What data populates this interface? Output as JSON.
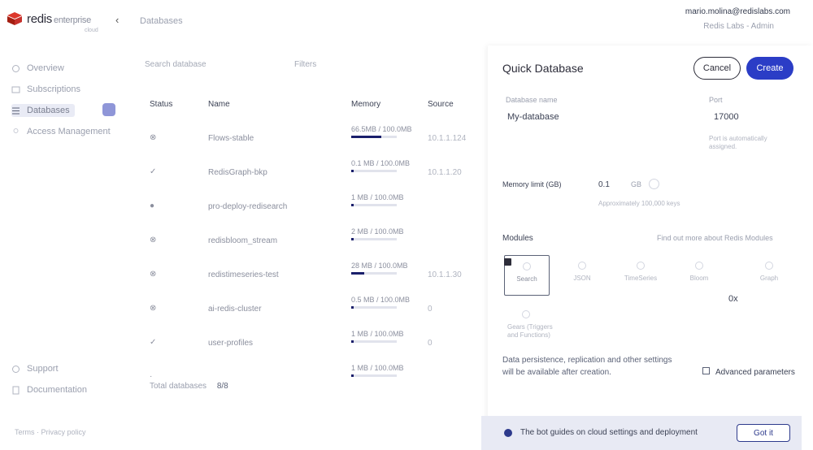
{
  "app": {
    "name": "redis",
    "edition": "enterprise",
    "sub": "cloud",
    "breadcrumb": "Databases"
  },
  "account": {
    "email": "mario.molina@redislabs.com",
    "plan": "Redis Labs - Admin"
  },
  "sidebar": {
    "items": [
      {
        "label": "Overview",
        "icon": "overview-icon"
      },
      {
        "label": "Subscriptions",
        "icon": "subscriptions-icon"
      },
      {
        "label": "Databases",
        "icon": "databases-icon"
      },
      {
        "label": "Access Management",
        "icon": "access-management-icon"
      },
      {
        "label": "Support",
        "icon": "support-icon"
      },
      {
        "label": "Documentation",
        "icon": "documentation-icon"
      }
    ],
    "footer": "Terms · Privacy policy"
  },
  "list": {
    "search_placeholder": "Search database",
    "filter_label": "Filters",
    "columns": [
      "Status",
      "Name",
      "Memory",
      "Source"
    ],
    "rows": [
      {
        "status": "",
        "name": "Flows-stable",
        "memory": "66.5MB / 100.0MB",
        "fill": 0.66,
        "source": "10.1.1.124"
      },
      {
        "status": "",
        "name": "RedisGraph-bkp",
        "memory": "0.1 MB / 100.0MB",
        "fill": 0.02,
        "source": "10.1.1.20"
      },
      {
        "status": "",
        "name": "pro-deploy-redisearch",
        "memory": "1 MB / 100.0MB",
        "fill": 0.02,
        "source": ""
      },
      {
        "status": "",
        "name": "redisbloom_stream",
        "memory": "2 MB / 100.0MB",
        "fill": 0.02,
        "source": ""
      },
      {
        "status": "",
        "name": "redistimeseries-test",
        "memory": "28 MB / 100.0MB",
        "fill": 0.28,
        "source": "10.1.1.30"
      },
      {
        "status": "",
        "name": "ai-redis-cluster",
        "memory": "0.5 MB / 100.0MB",
        "fill": 0.01,
        "source": "0"
      },
      {
        "status": "",
        "name": "user-profiles",
        "memory": "1 MB / 100.0MB",
        "fill": 0.02,
        "source": "0"
      },
      {
        "status": "",
        "name": "",
        "memory": "1 MB / 100.0MB",
        "fill": 0.02,
        "source": ""
      }
    ],
    "footer_label": "Total databases",
    "footer_value": "8/8"
  },
  "panel": {
    "title": "Quick Database",
    "cancel_label": "Cancel",
    "create_label": "Create",
    "db_name_label": "Database name",
    "db_name_value": "My-database",
    "port_label": "Port",
    "port_value": "17000",
    "port_hint": "Port is automatically assigned.",
    "memory_label": "Memory limit (GB)",
    "memory_value": "0.1",
    "memory_unit": "GB",
    "memory_hint": "Approximately 100,000 keys",
    "modules_label": "Modules",
    "modules_link": "Find out more about Redis Modules",
    "modules": [
      {
        "name": "Search",
        "selected": true
      },
      {
        "name": "JSON",
        "selected": false
      },
      {
        "name": "TimeSeries",
        "selected": false
      },
      {
        "name": "Bloom",
        "selected": false
      },
      {
        "name": "Graph",
        "selected": false
      }
    ],
    "extra_module": "Gears (Triggers and Functions)",
    "count_badge": "0x",
    "note_line1": "Data persistence, replication and other settings",
    "note_line2": "will be available after creation.",
    "advanced_label": "Advanced parameters"
  },
  "toast": {
    "text": "The bot guides on cloud settings and deployment",
    "button": "Got it"
  }
}
